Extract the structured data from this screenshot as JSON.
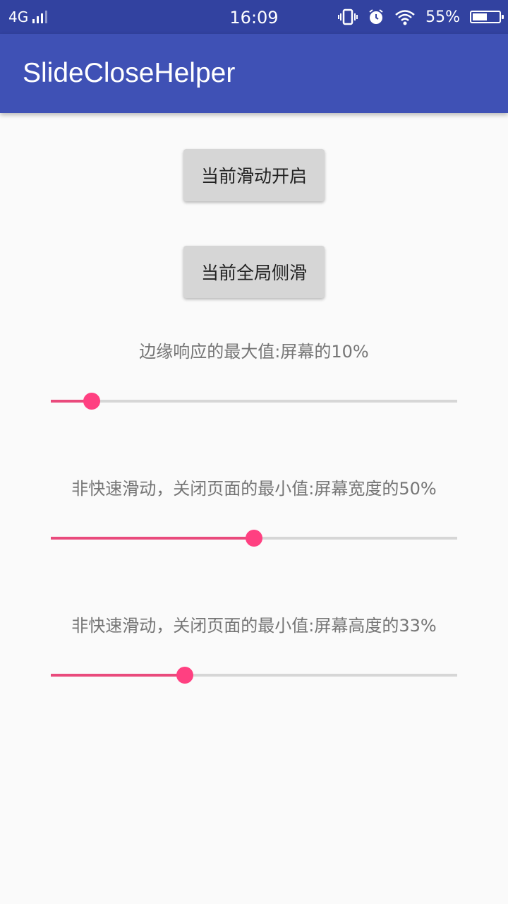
{
  "status_bar": {
    "network": "4G",
    "time": "16:09",
    "battery_percent": "55%",
    "icons": [
      "vibrate-icon",
      "alarm-icon",
      "wifi-icon",
      "battery-icon"
    ]
  },
  "app_bar": {
    "title": "SlideCloseHelper",
    "color": "#3f51b5"
  },
  "buttons": {
    "slide_toggle": "当前滑动开启",
    "global_slide": "当前全局侧滑"
  },
  "sliders": [
    {
      "label": "边缘响应的最大值:屏幕的10%",
      "value": 0.1
    },
    {
      "label": "非快速滑动，关闭页面的最小值:屏幕宽度的50%",
      "value": 0.5
    },
    {
      "label": "非快速滑动，关闭页面的最小值:屏幕高度的33%",
      "value": 0.33
    }
  ],
  "colors": {
    "accent": "#ff4081",
    "track": "#d6d6d6",
    "background": "#fafafa"
  }
}
